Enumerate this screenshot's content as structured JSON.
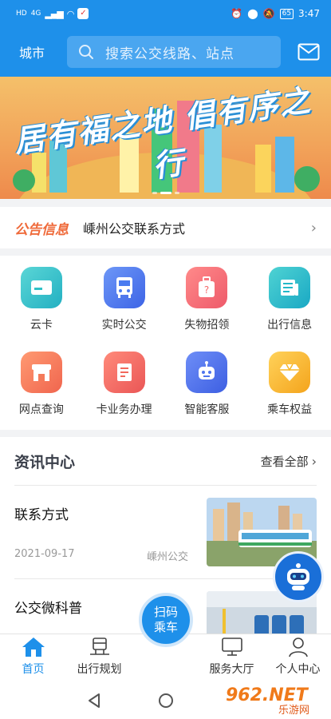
{
  "status_bar": {
    "left": "HD",
    "network": "4G",
    "battery": "65",
    "time": "3:47"
  },
  "header": {
    "city_label": "城市",
    "search_placeholder": "搜索公交线路、站点"
  },
  "banner": {
    "slogan": "居有福之地 倡有序之行"
  },
  "notice": {
    "tag": "公告信息",
    "text": "嵊州公交联系方式"
  },
  "services": [
    {
      "label": "云卡",
      "icon": "card-icon",
      "color": "#2fc1c6"
    },
    {
      "label": "实时公交",
      "icon": "bus-icon",
      "color": "#4a7bf0"
    },
    {
      "label": "失物招领",
      "icon": "luggage-icon",
      "color": "#f56a6a"
    },
    {
      "label": "出行信息",
      "icon": "newspaper-icon",
      "color": "#22b8c8"
    },
    {
      "label": "网点查询",
      "icon": "store-icon",
      "color": "#f47a5a"
    },
    {
      "label": "卡业务办理",
      "icon": "card-service-icon",
      "color": "#f2685c"
    },
    {
      "label": "智能客服",
      "icon": "robot-icon",
      "color": "#4e74ee"
    },
    {
      "label": "乘车权益",
      "icon": "diamond-icon",
      "color": "#f6b62a"
    }
  ],
  "news": {
    "title": "资讯中心",
    "view_all": "查看全部",
    "items": [
      {
        "title": "联系方式",
        "date": "2021-09-17",
        "source": "嵊州公交"
      },
      {
        "title": "公交微科普"
      }
    ]
  },
  "tabbar": {
    "home": "首页",
    "plan": "出行规划",
    "scan_line1": "扫码",
    "scan_line2": "乘车",
    "hall": "服务大厅",
    "profile": "个人中心"
  },
  "watermark": "962.NET 乐游网",
  "colors": {
    "primary": "#1e90ea",
    "notice_tag": "#ef6a3a"
  }
}
